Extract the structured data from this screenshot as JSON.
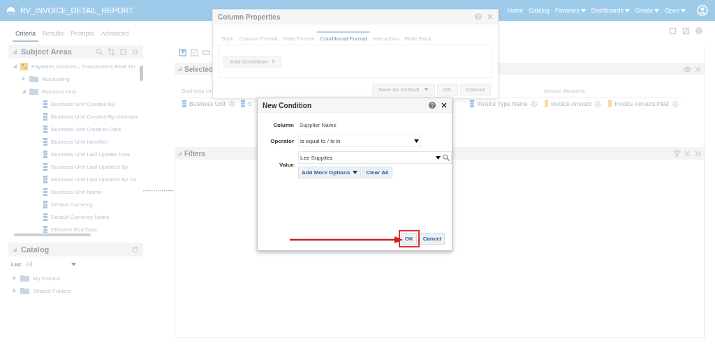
{
  "app_bar": {
    "title": "RV_INVOICE_DETAIL_REPORT",
    "nav": [
      {
        "label": "Home",
        "dropdown": false
      },
      {
        "label": "Catalog",
        "dropdown": false
      },
      {
        "label": "Favorites",
        "dropdown": true
      },
      {
        "label": "Dashboards",
        "dropdown": true
      },
      {
        "label": "Create",
        "dropdown": true
      },
      {
        "label": "Open",
        "dropdown": true
      }
    ]
  },
  "tabs": [
    {
      "label": "Criteria",
      "selected": true
    },
    {
      "label": "Results",
      "selected": false
    },
    {
      "label": "Prompts",
      "selected": false
    },
    {
      "label": "Advanced",
      "selected": false
    }
  ],
  "subject_areas": {
    "title": "Subject Areas",
    "tree": [
      {
        "label": "Payables Invoices - Transactions Real Tin",
        "kind": "subject",
        "expanded": true,
        "children": [
          {
            "label": "Accounting",
            "kind": "folder",
            "expanded": false
          },
          {
            "label": "Business Unit",
            "kind": "folder",
            "expanded": true,
            "children": [
              {
                "label": "Business Unit Created By",
                "kind": "column"
              },
              {
                "label": "Business Unit Created By Usernan",
                "kind": "column"
              },
              {
                "label": "Business Unit Creation Date",
                "kind": "column"
              },
              {
                "label": "Business Unit Identifier",
                "kind": "column"
              },
              {
                "label": "Business Unit Last Update Date",
                "kind": "column"
              },
              {
                "label": "Business Unit Last Updated By",
                "kind": "column"
              },
              {
                "label": "Business Unit Last Updated By Us",
                "kind": "column"
              },
              {
                "label": "Business Unit Name",
                "kind": "column"
              },
              {
                "label": "Default Currency",
                "kind": "column"
              },
              {
                "label": "Default Currency Name",
                "kind": "column"
              },
              {
                "label": "Effective End Date",
                "kind": "column"
              }
            ]
          }
        ]
      }
    ]
  },
  "catalog": {
    "title": "Catalog",
    "list_label": "List",
    "list_value": "All",
    "folders": [
      {
        "label": "My Folders",
        "expanded": false
      },
      {
        "label": "Shared Folders",
        "expanded": false
      }
    ]
  },
  "selected_columns": {
    "title": "Selected",
    "headings": [
      "Business Un",
      "Invoice Amounts"
    ],
    "columns": [
      {
        "label": "Business Unit",
        "kind": "attribute"
      },
      {
        "label": "S",
        "kind": "attribute"
      },
      {
        "label": "Invoice Type Name",
        "kind": "attribute"
      },
      {
        "label": "Invoice Amount",
        "kind": "measure"
      },
      {
        "label": "Invoice Amount Paid",
        "kind": "measure"
      }
    ]
  },
  "filters": {
    "title": "Filters"
  },
  "column_properties": {
    "title": "Column Properties",
    "tabs": [
      {
        "label": "Style",
        "selected": false
      },
      {
        "label": "Column Format",
        "selected": false
      },
      {
        "label": "Data Format",
        "selected": false
      },
      {
        "label": "Conditional Format",
        "selected": true
      },
      {
        "label": "Interaction",
        "selected": false
      },
      {
        "label": "Write Back",
        "selected": false
      }
    ],
    "add_condition": "Add Condition",
    "save_default": "Save as Default",
    "buttons": [
      "OK",
      "Cancel"
    ]
  },
  "new_condition": {
    "title": "New Condition",
    "column_label": "Column",
    "column_value": "Supplier Name",
    "operator_label": "Operator",
    "operator_value": "is equal to / is in",
    "value_label": "Value",
    "value_value": "Lee Supplies",
    "add_more": "Add More Options",
    "clear_all": "Clear All",
    "buttons": [
      {
        "label": "OK",
        "highlighted": true
      },
      {
        "label": "Cancel",
        "highlighted": false
      }
    ]
  }
}
